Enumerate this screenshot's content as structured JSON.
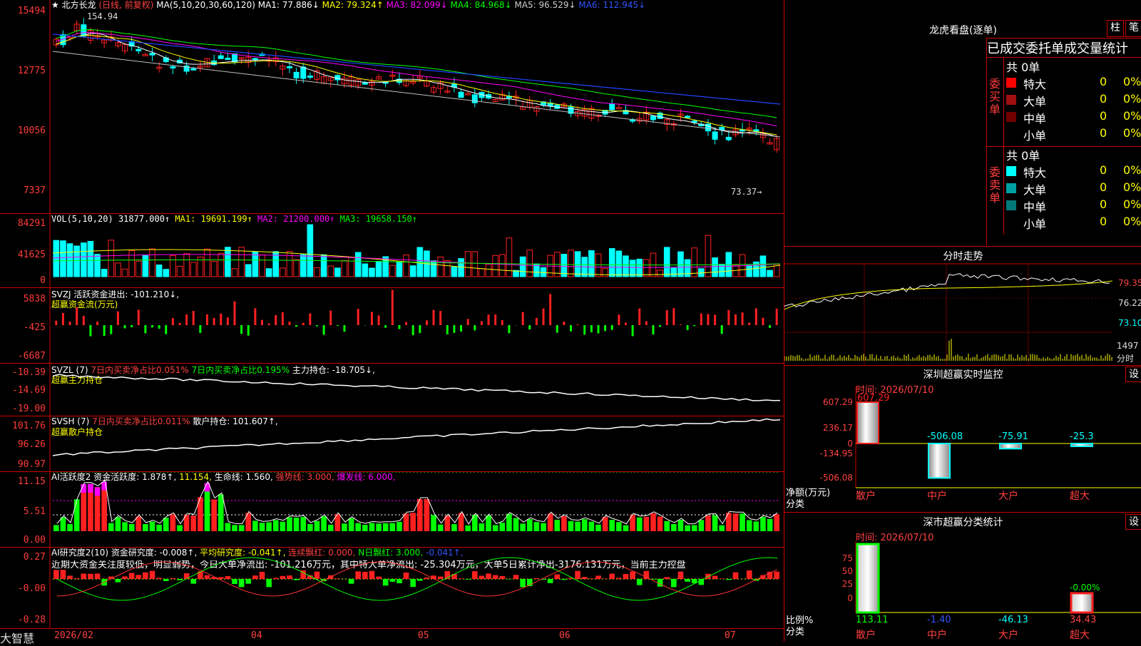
{
  "stock": {
    "star": "★",
    "name": "北方长龙",
    "period": "(日线, 前复权)"
  },
  "main_chart": {
    "ma_params": "MA(5,10,20,30,60,120)",
    "ma": [
      {
        "label": "MA1: 77.886↓",
        "color": "#ffffff"
      },
      {
        "label": "MA2: 79.324↑",
        "color": "#ffff00"
      },
      {
        "label": "MA3: 82.099↓",
        "color": "#ff00ff"
      },
      {
        "label": "MA4: 84.968↓",
        "color": "#00ff00"
      },
      {
        "label": "MA5: 96.529↓",
        "color": "#c0c0c0"
      },
      {
        "label": "MA6: 112.945↓",
        "color": "#2244ff"
      }
    ],
    "y_ticks": [
      "15494",
      "12775",
      "10056",
      "7337"
    ],
    "high_label": "154.94",
    "low_label": "73.37→"
  },
  "vol_panel": {
    "label": "VOL(5,10,20)",
    "value": "31877.000↑",
    "ma1": "MA1: 19691.199↑",
    "ma2": "MA2: 21200.000↑",
    "ma3": "MA3: 19658.150↑",
    "y_ticks": [
      "84291",
      "41625",
      "0"
    ]
  },
  "svzj_panel": {
    "label": "SVZJ",
    "text": "活跃资金进出: -101.210↓,",
    "title2": "超赢资金流(万元)",
    "y_ticks": [
      "5838",
      "-425",
      "-6687"
    ]
  },
  "svzl_panel": {
    "label": "SVZL (7)",
    "t1": "7日内买卖净占比0.051%",
    "t2": "7日内买卖净占比0.195%",
    "t3": "主力持仓: -18.705↓,",
    "title2": "超赢主力持仓",
    "y_ticks": [
      "-10.39",
      "-14.69",
      "-19.00"
    ]
  },
  "svsh_panel": {
    "label": "SVSH (7)",
    "t1": "7日内买卖净占比0.011%",
    "t2": "散户持仓: 101.607↑,",
    "title2": "超赢散户持仓",
    "y_ticks": [
      "101.76",
      "96.26",
      "90.97"
    ]
  },
  "ai_active": {
    "label": "AI活跃度2",
    "t1": "资金活跃度: 1.878↑,",
    "t2": "11.154,",
    "t3": "生命线: 1.560,",
    "t4": "强势线: 3.000,",
    "t5": "爆发线: 6.000,",
    "y_ticks": [
      "11.15",
      "5.51",
      "0.00"
    ]
  },
  "ai_research": {
    "label": "AI研究度2(10)",
    "t1": "资金研究度: -0.008↑,",
    "t2": "平均研究度: -0.041↑,",
    "t3": "连续飘红: 0.000,",
    "t4": "N日飘红: 3.000,",
    "t5": "-0.041↑,",
    "comment": "近期大资金关注度较低，明显弱势，今日大单净流出: -101.216万元，其中特大单净流出: -25.304万元，大单5日累计净出-3176.131万元，当前主力控盘",
    "y_ticks": [
      "0.27",
      "-0.00",
      "-0.28"
    ]
  },
  "x_axis": {
    "brand": "大智慧",
    "labels": [
      "2026/02",
      "04",
      "05",
      "06",
      "07"
    ]
  },
  "right": {
    "title": "龙虎看盘(逐单)",
    "tab_zhu": "柱",
    "tab_bi": "笔",
    "stats_header": "已成交委托单成交量统计",
    "buy": {
      "side_label": "委买单",
      "total": "共 0单",
      "rows": [
        {
          "name": "特大",
          "count": "0",
          "pct": "0%",
          "color": "#ff0000"
        },
        {
          "name": "大单",
          "count": "0",
          "pct": "0%",
          "color": "#a01010"
        },
        {
          "name": "中单",
          "count": "0",
          "pct": "0%",
          "color": "#700000"
        },
        {
          "name": "小单",
          "count": "0",
          "pct": "0%",
          "color": "#000000"
        }
      ]
    },
    "sell": {
      "side_label": "委卖单",
      "total": "共 0单",
      "rows": [
        {
          "name": "特大",
          "count": "0",
          "pct": "0%",
          "color": "#00ffff"
        },
        {
          "name": "大单",
          "count": "0",
          "pct": "0%",
          "color": "#00a0a0"
        },
        {
          "name": "中单",
          "count": "0",
          "pct": "0%",
          "color": "#007878"
        },
        {
          "name": "小单",
          "count": "0",
          "pct": "0%",
          "color": "#000000"
        }
      ]
    },
    "intraday": {
      "title": "分时走势",
      "y_ticks": [
        "79.35",
        "76.22",
        "73.10",
        "1497"
      ],
      "unit": "分时"
    },
    "monitor": {
      "title": "深圳超赢实时监控",
      "settings": "设",
      "time": "时间: 2026/07/10",
      "y_ticks": [
        "607.29",
        "236.17",
        "0",
        "-134.95",
        "-506.08"
      ],
      "values": [
        "607.29",
        "-506.08",
        "-75.91",
        "-25.3"
      ],
      "axis_label_1": "净额(万元)",
      "axis_label_2": "分类",
      "categories": [
        "散户",
        "中户",
        "大户",
        "超大"
      ]
    },
    "stats": {
      "title": "深市超赢分类统计",
      "settings": "设",
      "time": "时间: 2026/07/10",
      "y_ticks": [
        "75",
        "50",
        "25",
        "0"
      ],
      "values": [
        "113.11",
        "-1.40",
        "-46.13",
        "34.43"
      ],
      "top_label": "-0.00%",
      "axis_label_1": "比例%",
      "axis_label_2": "分类",
      "categories": [
        "散户",
        "中户",
        "大户",
        "超大"
      ]
    }
  },
  "colors": {
    "up": "#ff2020",
    "down": "#00ffff",
    "border": "#cc0000"
  }
}
